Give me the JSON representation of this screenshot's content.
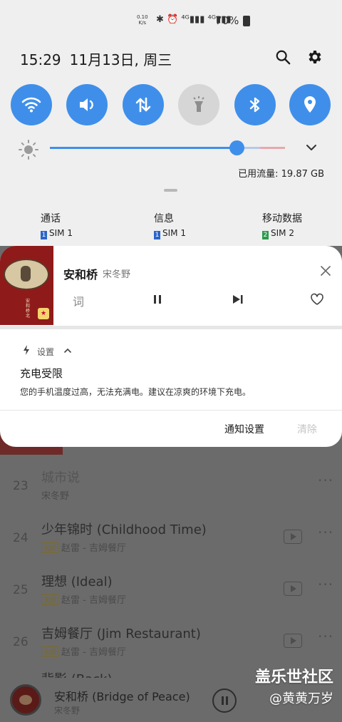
{
  "status_bar": {
    "net_speed_top": "0.10",
    "net_speed_unit": "K/s",
    "icons_text": "✱ ⏰ ⁴ᴳ▮▮▮ ⁴ᴳ▮▮▮",
    "battery_percent": "70%"
  },
  "header": {
    "time": "15:29",
    "date": "11月13日, 周三"
  },
  "quick_settings": {
    "accent_color": "#3f8fea",
    "tiles": [
      {
        "name": "wifi",
        "state": "on"
      },
      {
        "name": "sound",
        "state": "on"
      },
      {
        "name": "mobile-data",
        "state": "on"
      },
      {
        "name": "flashlight",
        "state": "off"
      },
      {
        "name": "bluetooth",
        "state": "on"
      },
      {
        "name": "location",
        "state": "on"
      }
    ]
  },
  "brightness": {
    "level_fraction": 0.795
  },
  "data_usage": "已用流量: 19.87 GB",
  "sim_row": [
    {
      "label": "通话",
      "sim_num": "1",
      "sim_text": "SIM 1",
      "color": "#2a66c8"
    },
    {
      "label": "信息",
      "sim_num": "1",
      "sim_text": "SIM 1",
      "color": "#2a66c8"
    },
    {
      "label": "移动数据",
      "sim_num": "2",
      "sim_text": "SIM 2",
      "color": "#2a9a4a"
    }
  ],
  "music_notification": {
    "title": "安和桥",
    "artist": "宋冬野",
    "lyric_label": "词",
    "album_text": "安和桥北"
  },
  "charging_notification": {
    "app": "设置",
    "title": "充电受限",
    "body": "您的手机温度过高，无法充满电。建议在凉爽的环境下充电。",
    "settings_action": "通知设置",
    "clear_action": "清除"
  },
  "background_list": [
    {
      "num": "23",
      "title": "城市说",
      "artist": "宋冬野",
      "tag": ""
    },
    {
      "num": "24",
      "title": "少年锦时 (Childhood Time)",
      "artist": "赵雷 - 吉姆餐厅",
      "tag": "无损"
    },
    {
      "num": "25",
      "title": "理想 (Ideal)",
      "artist": "赵雷 - 吉姆餐厅",
      "tag": "无损"
    },
    {
      "num": "26",
      "title": "吉姆餐厅 (Jim Restaurant)",
      "artist": "赵雷 - 吉姆餐厅",
      "tag": "无损"
    },
    {
      "num": "",
      "title": "背影 (Back)",
      "artist": "",
      "tag": ""
    }
  ],
  "mini_player": {
    "title": "安和桥 (Bridge of Peace)",
    "artist": "宋冬野"
  },
  "watermark": {
    "line1": "盖乐世社区",
    "line2": "@黄黄万岁"
  }
}
